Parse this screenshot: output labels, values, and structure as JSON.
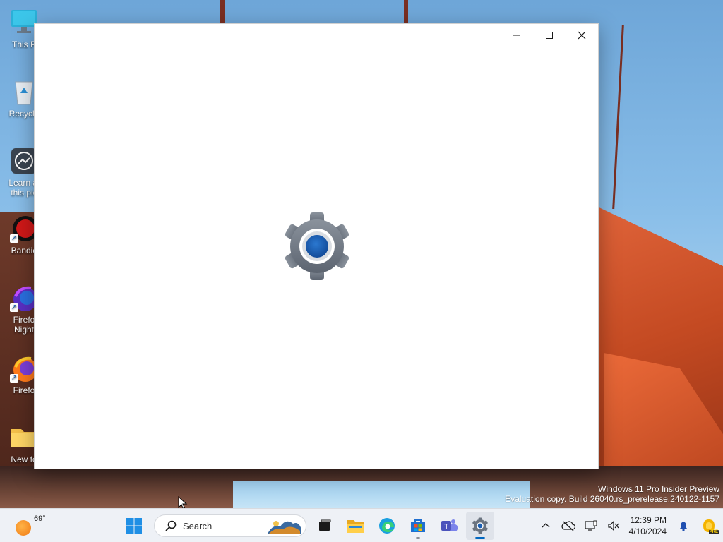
{
  "desktop": {
    "icons": [
      {
        "label": "This P",
        "icon": "computer-icon"
      },
      {
        "label": "Recycle",
        "icon": "recycle-bin-icon"
      },
      {
        "label": "Learn al",
        "label2": "this pic",
        "icon": "learn-picture-icon"
      },
      {
        "label": "Bandic",
        "icon": "bandicam-icon"
      },
      {
        "label": "Firefo",
        "label2": "Night",
        "icon": "firefox-nightly-icon"
      },
      {
        "label": "Firefo",
        "icon": "firefox-icon"
      },
      {
        "label": "New fo",
        "icon": "folder-icon"
      }
    ]
  },
  "window": {
    "app": "Settings",
    "splash_icon": "settings-gear-icon",
    "caption": {
      "minimize_icon": "minimize-icon",
      "maximize_icon": "maximize-icon",
      "close_icon": "close-icon"
    }
  },
  "watermark": {
    "line1": "Windows 11 Pro Insider Preview",
    "line2": "Evaluation copy. Build 26040.rs_prerelease.240122-1157"
  },
  "taskbar": {
    "weather": {
      "temp": "69°",
      "icon": "weather-sun-icon"
    },
    "start_icon": "windows-start-icon",
    "search": {
      "placeholder": "Search",
      "icon": "search-icon"
    },
    "apps": [
      {
        "name": "Task View",
        "icon": "task-view-icon"
      },
      {
        "name": "File Explorer",
        "icon": "file-explorer-icon"
      },
      {
        "name": "Microsoft Edge",
        "icon": "edge-icon"
      },
      {
        "name": "Microsoft Store",
        "icon": "store-icon"
      },
      {
        "name": "Microsoft Teams",
        "icon": "teams-icon"
      },
      {
        "name": "Settings",
        "icon": "settings-icon",
        "active": true
      }
    ],
    "tray": {
      "chevron_icon": "chevron-up-icon",
      "network_icon": "onedrive-offline-icon",
      "display_icon": "display-icon",
      "volume_icon": "volume-muted-icon",
      "time": "12:39 PM",
      "date": "4/10/2024",
      "notification_icon": "bell-icon",
      "copilot_icon": "copilot-icon",
      "copilot_badge": "PRE"
    }
  },
  "colors": {
    "accent": "#0067c0",
    "gear_gray": "#6b7480",
    "gear_blue": "#1a5fb4"
  }
}
